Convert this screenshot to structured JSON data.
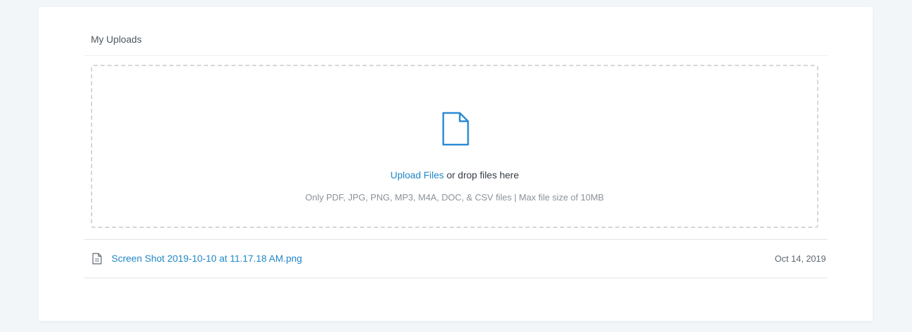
{
  "uploads": {
    "title": "My Uploads",
    "dropzone": {
      "icon": "file-icon",
      "upload_link": "Upload Files",
      "drop_text": " or drop files here",
      "hint": "Only PDF, JPG, PNG, MP3, M4A, DOC, & CSV files | Max file size of 10MB"
    },
    "files": [
      {
        "icon": "document-icon",
        "name": "Screen Shot 2019-10-10 at 11.17.18 AM.png",
        "date": "Oct 14, 2019"
      }
    ]
  },
  "colors": {
    "link": "#1f86c7",
    "icon_accent": "#2b8ad3",
    "background": "#f3f6f9",
    "card": "#ffffff"
  }
}
